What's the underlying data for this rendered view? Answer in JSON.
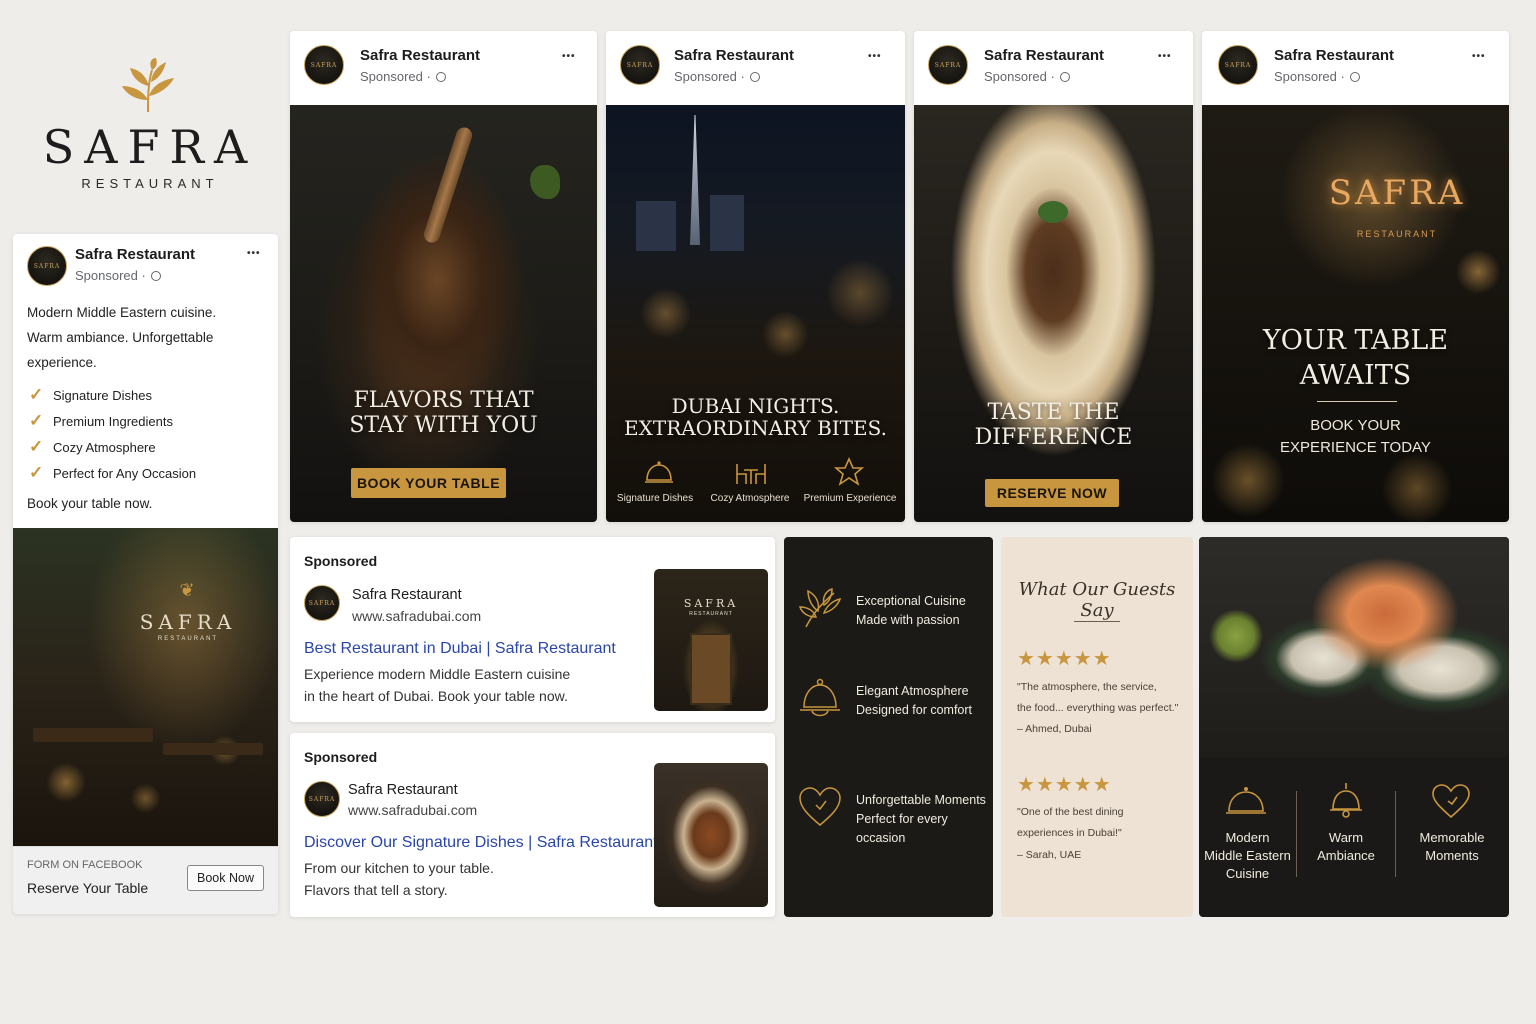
{
  "brand": {
    "name": "SAFRA",
    "sub": "RESTAURANT",
    "avatar_text": "SAFRA"
  },
  "post": {
    "name": "Safra Restaurant",
    "sponsored": "Sponsored ·",
    "menu": "•••"
  },
  "feed": {
    "intro_line1": "Modern Middle Eastern cuisine.",
    "intro_line2": "Warm ambiance. Unforgettable",
    "intro_line3": "experience.",
    "checks": [
      "Signature Dishes",
      "Premium Ingredients",
      "Cozy Atmosphere",
      "Perfect for Any Occasion"
    ],
    "cta_text": "Book your table now.",
    "photo_sign": "SAFRA",
    "photo_sign_sub": "RESTAURANT",
    "form_label": "FORM ON FACEBOOK",
    "form_title": "Reserve Your Table",
    "form_button": "Book Now"
  },
  "panels": {
    "p1": {
      "line1": "FLAVORS THAT",
      "line2": "STAY WITH YOU",
      "button": "BOOK YOUR TABLE"
    },
    "p2": {
      "line1": "DUBAI NIGHTS.",
      "line2": "EXTRAORDINARY BITES.",
      "icons": [
        "Signature Dishes",
        "Cozy Atmosphere",
        "Premium Experience"
      ]
    },
    "p3": {
      "line1": "TASTE THE",
      "line2": "DIFFERENCE",
      "button": "RESERVE NOW"
    },
    "p4": {
      "sign": "SAFRA",
      "sign_sub": "RESTAURANT",
      "line1": "YOUR TABLE",
      "line2": "AWAITS",
      "sub1": "BOOK YOUR",
      "sub2": "EXPERIENCE TODAY"
    }
  },
  "search_ads": [
    {
      "sponsored": "Sponsored",
      "name": "Safra Restaurant",
      "url": "www.safradubai.com",
      "title": "Best Restaurant in Dubai | Safra Restaurant",
      "desc1": "Experience modern Middle Eastern cuisine",
      "desc2": "in the heart of Dubai. Book your table now.",
      "thumb_sign": "SAFRA",
      "thumb_sign_sub": "RESTAURANT"
    },
    {
      "sponsored": "Sponsored",
      "name": "Safra Restaurant",
      "url": "www.safradubai.com",
      "title": "Discover Our Signature Dishes | Safra Restaurant",
      "desc1": "From our kitchen to your table.",
      "desc2": "Flavors that tell a story."
    }
  ],
  "features": [
    {
      "title": "Exceptional Cuisine",
      "sub": "Made with passion",
      "icon": "leaf-icon"
    },
    {
      "title": "Elegant Atmosphere",
      "sub": "Designed for comfort",
      "icon": "cloche-icon"
    },
    {
      "title": "Unforgettable Moments",
      "sub": "Perfect for every occasion",
      "icon": "heart-icon"
    }
  ],
  "reviews": {
    "heading": "What Our Guests Say",
    "stars": "★★★★★",
    "items": [
      {
        "q1": "\"The atmosphere, the service,",
        "q2": "the food... everything was perfect.\"",
        "author": "– Ahmed, Dubai"
      },
      {
        "q1": "\"One of the best dining",
        "q2": "experiences in Dubai!\"",
        "author": "– Sarah, UAE"
      }
    ]
  },
  "sushi": {
    "labels": [
      {
        "l1": "Modern",
        "l2": "Middle Eastern",
        "l3": "Cuisine"
      },
      {
        "l1": "Warm",
        "l2": "Ambiance"
      },
      {
        "l1": "Memorable",
        "l2": "Moments"
      }
    ]
  },
  "colors": {
    "gold": "#c8963f",
    "dark": "#1b1a17",
    "link": "#2a46a8",
    "cream": "#ede2d4"
  }
}
